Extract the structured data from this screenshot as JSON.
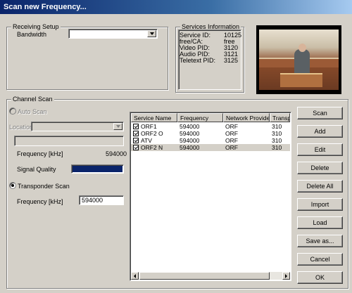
{
  "window": {
    "title": "Scan new Frequency..."
  },
  "receiving_setup": {
    "group_title": "Receiving Setup",
    "bandwidth_label": "Bandwidth",
    "bandwidth_value": ""
  },
  "services_info": {
    "group_title": "Services Information",
    "rows": [
      {
        "label": "Service ID:",
        "value": "10125"
      },
      {
        "label": "free/CA:",
        "value": "free"
      },
      {
        "label": "Video PID:",
        "value": "3120"
      },
      {
        "label": "Audio PID:",
        "value": "3121"
      },
      {
        "label": "Teletext PID:",
        "value": "3125"
      }
    ]
  },
  "channel_scan": {
    "group_title": "Channel Scan",
    "auto_scan_label": "Auto Scan",
    "location_label": "Location",
    "location_value": "",
    "frequency_label": "Frequency [kHz]",
    "frequency_value": "594000",
    "signal_quality_label": "Signal Quality",
    "signal_quality_level": 1.0,
    "transponder_scan_label": "Transponder Scan",
    "transponder_frequency_label": "Frequency [kHz]",
    "transponder_frequency_value": "594000"
  },
  "services_list": {
    "columns": [
      "Service Name",
      "Frequency",
      "Network Provider",
      "Transpo"
    ],
    "rows": [
      {
        "name": "ORF1",
        "frequency": "594000",
        "provider": "ORF",
        "transponder": "310"
      },
      {
        "name": "ORF2 O",
        "frequency": "594000",
        "provider": "ORF",
        "transponder": "310"
      },
      {
        "name": "ATV",
        "frequency": "594000",
        "provider": "ORF",
        "transponder": "310"
      },
      {
        "name": "ORF2 N",
        "frequency": "594000",
        "provider": "ORF",
        "transponder": "310"
      }
    ]
  },
  "buttons": {
    "scan": "Scan",
    "add": "Add",
    "edit": "Edit",
    "delete": "Delete",
    "delete_all": "Delete All",
    "import": "Import",
    "load": "Load",
    "save_as": "Save as...",
    "cancel": "Cancel",
    "ok": "OK"
  },
  "colors": {
    "title_bar": "#0a246a",
    "signal_quality_bar": "#0a246a",
    "dialog_background": "#d4d0c8"
  },
  "icons": {
    "checkbox": "checkmark-icon",
    "scroll_left": "arrow-left-icon",
    "scroll_right": "arrow-right-icon",
    "dropdown": "chevron-down-icon"
  }
}
